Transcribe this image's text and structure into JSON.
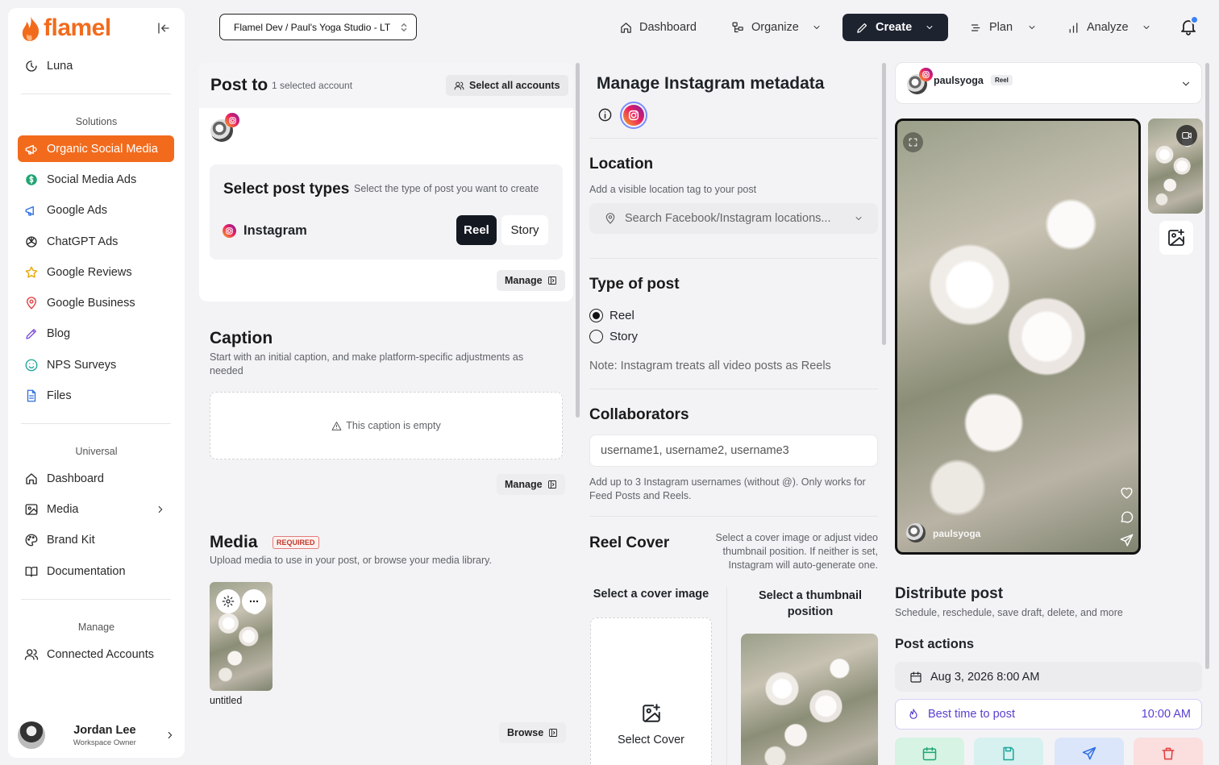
{
  "app": {
    "logo": "flamel",
    "workspace": "Flamel Dev / Paul's Yoga Studio - LT"
  },
  "colors": {
    "brand": "#f26b1d",
    "dark": "#1e2330"
  },
  "sidebar": {
    "luna": "Luna",
    "solutions_heading": "Solutions",
    "solutions": [
      {
        "label": "Organic Social Media",
        "icon": "megaphone-icon",
        "active": true
      },
      {
        "label": "Social Media Ads",
        "icon": "dollar-icon"
      },
      {
        "label": "Google Ads",
        "icon": "megaphone-icon"
      },
      {
        "label": "ChatGPT Ads",
        "icon": "openai-icon"
      },
      {
        "label": "Google Reviews",
        "icon": "star-icon"
      },
      {
        "label": "Google Business",
        "icon": "map-pin-icon"
      },
      {
        "label": "Blog",
        "icon": "pen-icon"
      },
      {
        "label": "NPS Surveys",
        "icon": "smile-icon"
      },
      {
        "label": "Files",
        "icon": "file-icon"
      }
    ],
    "universal_heading": "Universal",
    "universal": [
      {
        "label": "Dashboard",
        "icon": "home-icon"
      },
      {
        "label": "Media",
        "icon": "image-icon"
      },
      {
        "label": "Brand Kit",
        "icon": "palette-icon"
      },
      {
        "label": "Documentation",
        "icon": "book-icon"
      }
    ],
    "manage_heading": "Manage",
    "manage": [
      {
        "label": "Connected Accounts",
        "icon": "users-icon"
      }
    ],
    "user": {
      "name": "Jordan Lee",
      "role": "Workspace Owner"
    }
  },
  "topnav": {
    "dashboard": "Dashboard",
    "organize": "Organize",
    "create": "Create",
    "plan": "Plan",
    "analyze": "Analyze"
  },
  "post_to": {
    "title": "Post to",
    "selected": "1 selected account",
    "select_all": "Select all accounts",
    "post_types_title": "Select post types",
    "post_types_sub": "Select the type of post you want to create",
    "platform": "Instagram",
    "types": [
      "Reel",
      "Story"
    ],
    "selected_type": "Reel",
    "manage": "Manage"
  },
  "caption": {
    "title": "Caption",
    "sub": "Start with an initial caption, and make platform-specific adjustments as needed",
    "empty": "This caption is empty",
    "manage": "Manage"
  },
  "media": {
    "title": "Media",
    "required": "REQUIRED",
    "sub": "Upload media to use in your post, or browse your media library.",
    "file_name": "untitled",
    "browse": "Browse"
  },
  "metadata": {
    "title": "Manage Instagram metadata",
    "location_title": "Location",
    "location_sub": "Add a visible location tag to your post",
    "location_placeholder": "Search Facebook/Instagram locations...",
    "type_title": "Type of post",
    "type_options": [
      "Reel",
      "Story"
    ],
    "type_selected": "Reel",
    "type_note": "Note: Instagram treats all video posts as Reels",
    "collab_title": "Collaborators",
    "collab_placeholder": "username1, username2, username3",
    "collab_help": "Add up to 3 Instagram usernames (without @). Only works for Feed Posts and Reels.",
    "cover_title": "Reel Cover",
    "cover_help": "Select a cover image or adjust video thumbnail position. If neither is set, Instagram will auto-generate one.",
    "cover_image_label": "Select a cover image",
    "thumb_label": "Select a thumbnail position",
    "select_cover": "Select Cover"
  },
  "preview": {
    "account": "paulsyoga",
    "badge": "Reel",
    "overlay_account": "paulsyoga"
  },
  "distribute": {
    "title": "Distribute post",
    "sub": "Schedule, reschedule, save draft, delete, and more",
    "actions_title": "Post actions",
    "date": "Aug 3, 2026 8:00 AM",
    "best_time": "Best time to post",
    "best_time_value": "10:00 AM"
  }
}
